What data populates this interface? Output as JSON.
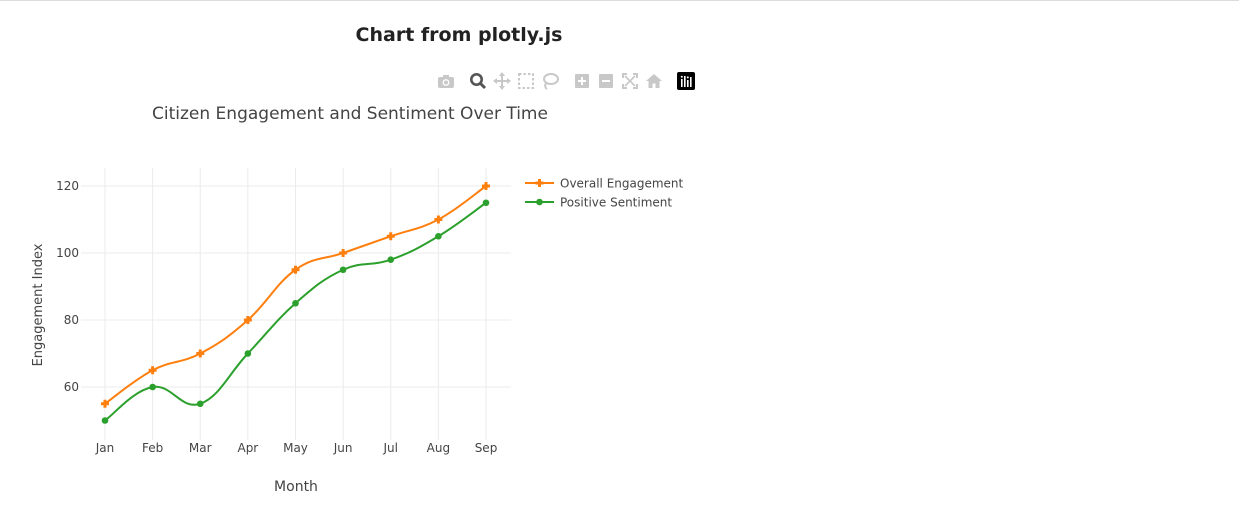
{
  "page": {
    "title": "Chart from plotly.js"
  },
  "modebar": {
    "buttons": [
      {
        "icon": "camera-icon"
      },
      {
        "icon": "zoom-icon"
      },
      {
        "icon": "pan-icon"
      },
      {
        "icon": "box-select-icon"
      },
      {
        "icon": "lasso-select-icon"
      },
      {
        "icon": "zoom-in-icon"
      },
      {
        "icon": "zoom-out-icon"
      },
      {
        "icon": "autoscale-icon"
      },
      {
        "icon": "reset-axes-icon"
      },
      {
        "icon": "plotly-logo-icon"
      }
    ]
  },
  "chart_data": {
    "type": "line",
    "title": "Citizen Engagement and Sentiment Over Time",
    "xlabel": "Month",
    "ylabel": "Engagement Index",
    "categories": [
      "Jan",
      "Feb",
      "Mar",
      "Apr",
      "May",
      "Jun",
      "Jul",
      "Aug",
      "Sep"
    ],
    "ylim": [
      45,
      125
    ],
    "yticks": [
      60,
      80,
      100,
      120
    ],
    "grid": true,
    "legend_position": "top-right",
    "series": [
      {
        "name": "Overall Engagement",
        "values": [
          55,
          65,
          70,
          80,
          95,
          100,
          105,
          110,
          120
        ],
        "color": "#ff7f0e",
        "marker": "cross"
      },
      {
        "name": "Positive Sentiment",
        "values": [
          50,
          60,
          55,
          70,
          85,
          95,
          98,
          105,
          115
        ],
        "color": "#2ca02c",
        "marker": "circle"
      }
    ]
  }
}
